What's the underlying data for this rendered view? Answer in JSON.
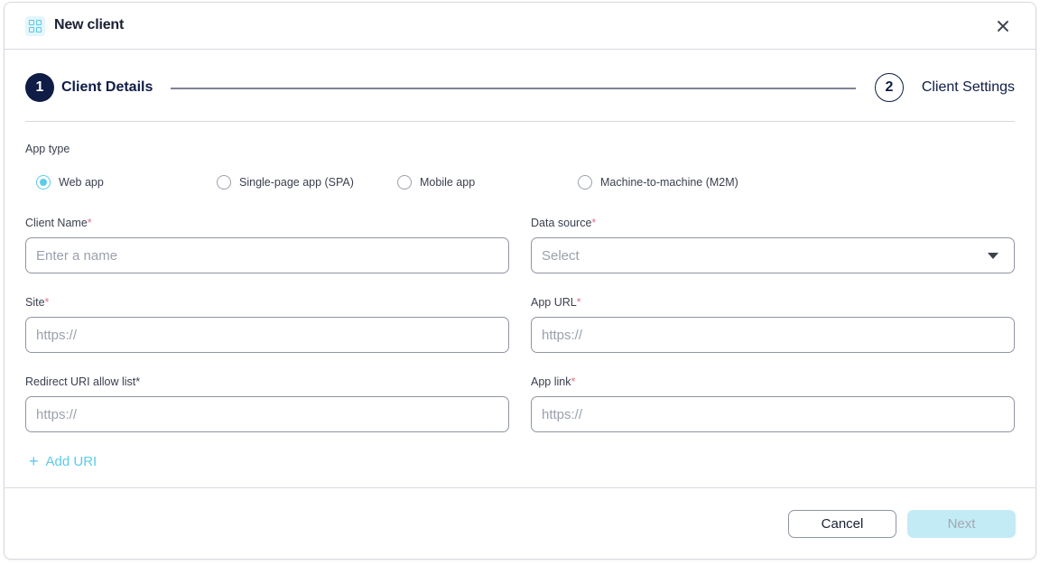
{
  "dialog": {
    "title": "New client",
    "icon": "grid-icon",
    "close_icon": "close-icon"
  },
  "stepper": {
    "steps": [
      {
        "number": "1",
        "label": "Client Details",
        "state": "active"
      },
      {
        "number": "2",
        "label": "Client Settings",
        "state": "inactive"
      }
    ]
  },
  "form": {
    "app_type": {
      "label": "App type",
      "selected": "Web app",
      "options": [
        "Web app",
        "Single-page app (SPA)",
        "Mobile app",
        "Machine-to-machine (M2M)"
      ]
    },
    "client_name": {
      "label": "Client Name",
      "required_mark": "*",
      "placeholder": "Enter a name",
      "value": ""
    },
    "data_source": {
      "label": "Data source",
      "required_mark": "*",
      "placeholder": "Select",
      "value": ""
    },
    "site": {
      "label": "Site",
      "required_mark": "*",
      "placeholder": "https://",
      "value": ""
    },
    "app_url": {
      "label": "App URL",
      "required_mark": "*",
      "placeholder": "https://",
      "value": ""
    },
    "redirect_uri": {
      "label": "Redirect URI allow list",
      "required_mark": "*",
      "placeholder": "https://",
      "value": ""
    },
    "app_link": {
      "label": "App link",
      "required_mark": "*",
      "placeholder": "https://",
      "value": ""
    },
    "add_uri": {
      "icon": "+",
      "label": "Add URI"
    }
  },
  "footer": {
    "cancel_label": "Cancel",
    "next_label": "Next"
  },
  "colors": {
    "accent": "#5bcbe8",
    "primary_dark": "#0f1c45",
    "required": "#e0748a",
    "next_disabled_bg": "#c2ebf5"
  }
}
